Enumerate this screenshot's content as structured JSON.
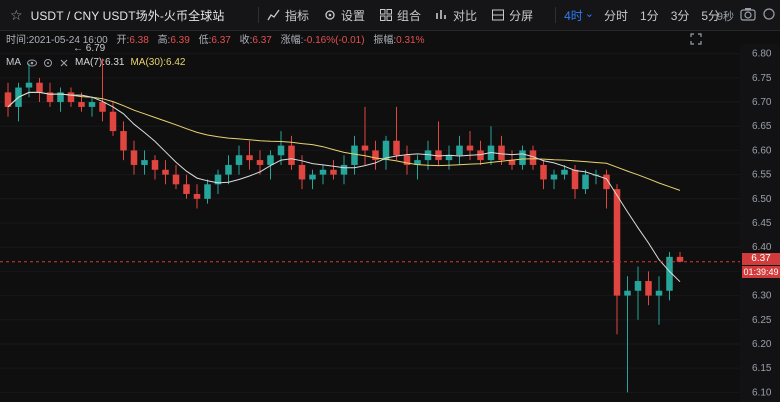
{
  "toolbar": {
    "symbol": "USDT / CNY  USDT场外-火币全球站",
    "tools": [
      {
        "label": "指标",
        "icon": "indicator-icon"
      },
      {
        "label": "设置",
        "icon": "gear-icon"
      },
      {
        "label": "组合",
        "icon": "grid-icon"
      },
      {
        "label": "对比",
        "icon": "compare-icon"
      },
      {
        "label": "分屏",
        "icon": "split-icon"
      }
    ],
    "periods": [
      "4时",
      "分时",
      "1分",
      "3分",
      "5分"
    ],
    "active_period": "4时",
    "countdown": "9秒"
  },
  "info": {
    "time_label": "时间:",
    "time_value": "2021-05-24 16:00",
    "open_label": "开:",
    "open_value": "6.38",
    "high_label": "高:",
    "high_value": "6.39",
    "low_label": "低:",
    "low_value": "6.37",
    "close_label": "收:",
    "close_value": "6.37",
    "change_label": "涨幅:",
    "change_value": "-0.16%(-0.01)",
    "amp_label": "振幅:",
    "amp_value": "0.31%"
  },
  "ma": {
    "name": "MA",
    "ma7_label": "MA(7):6.31",
    "ma30_label": "MA(30):6.42"
  },
  "peak_label": "6.79",
  "price_tag": "6.37",
  "time_tag": "01:39:49",
  "colors": {
    "up": "#26a69a",
    "down": "#e0463f",
    "ma7": "#dcdcdc",
    "ma30": "#e8d36f",
    "accent": "#2f7cf6"
  },
  "chart_data": {
    "type": "candlestick",
    "y_ticks": [
      "6.80",
      "6.75",
      "6.70",
      "6.65",
      "6.60",
      "6.55",
      "6.50",
      "6.45",
      "6.40",
      "6.35",
      "6.30",
      "6.25",
      "6.20",
      "6.15",
      "6.10"
    ],
    "ylim": [
      6.08,
      6.82
    ],
    "current_price": 6.37,
    "candles": [
      [
        6.72,
        6.74,
        6.67,
        6.69
      ],
      [
        6.69,
        6.74,
        6.66,
        6.73
      ],
      [
        6.73,
        6.78,
        6.71,
        6.74
      ],
      [
        6.74,
        6.75,
        6.7,
        6.72
      ],
      [
        6.72,
        6.74,
        6.69,
        6.7
      ],
      [
        6.7,
        6.73,
        6.68,
        6.72
      ],
      [
        6.72,
        6.73,
        6.69,
        6.7
      ],
      [
        6.7,
        6.72,
        6.68,
        6.69
      ],
      [
        6.69,
        6.71,
        6.67,
        6.7
      ],
      [
        6.7,
        6.79,
        6.66,
        6.68
      ],
      [
        6.68,
        6.7,
        6.63,
        6.64
      ],
      [
        6.64,
        6.66,
        6.58,
        6.6
      ],
      [
        6.6,
        6.62,
        6.55,
        6.57
      ],
      [
        6.57,
        6.6,
        6.55,
        6.58
      ],
      [
        6.58,
        6.59,
        6.54,
        6.56
      ],
      [
        6.56,
        6.58,
        6.53,
        6.55
      ],
      [
        6.55,
        6.57,
        6.52,
        6.53
      ],
      [
        6.53,
        6.55,
        6.5,
        6.51
      ],
      [
        6.51,
        6.53,
        6.48,
        6.5
      ],
      [
        6.5,
        6.54,
        6.49,
        6.53
      ],
      [
        6.53,
        6.56,
        6.51,
        6.55
      ],
      [
        6.55,
        6.59,
        6.53,
        6.57
      ],
      [
        6.57,
        6.61,
        6.55,
        6.59
      ],
      [
        6.59,
        6.62,
        6.56,
        6.58
      ],
      [
        6.58,
        6.6,
        6.55,
        6.57
      ],
      [
        6.57,
        6.6,
        6.54,
        6.59
      ],
      [
        6.59,
        6.64,
        6.57,
        6.61
      ],
      [
        6.61,
        6.63,
        6.56,
        6.57
      ],
      [
        6.57,
        6.59,
        6.52,
        6.54
      ],
      [
        6.54,
        6.56,
        6.52,
        6.55
      ],
      [
        6.55,
        6.57,
        6.53,
        6.56
      ],
      [
        6.56,
        6.58,
        6.54,
        6.55
      ],
      [
        6.55,
        6.59,
        6.53,
        6.57
      ],
      [
        6.57,
        6.63,
        6.55,
        6.61
      ],
      [
        6.61,
        6.69,
        6.57,
        6.6
      ],
      [
        6.6,
        6.62,
        6.56,
        6.58
      ],
      [
        6.58,
        6.63,
        6.56,
        6.62
      ],
      [
        6.62,
        6.69,
        6.58,
        6.59
      ],
      [
        6.59,
        6.61,
        6.55,
        6.57
      ],
      [
        6.57,
        6.59,
        6.54,
        6.58
      ],
      [
        6.58,
        6.62,
        6.56,
        6.6
      ],
      [
        6.6,
        6.66,
        6.57,
        6.58
      ],
      [
        6.58,
        6.61,
        6.56,
        6.59
      ],
      [
        6.59,
        6.63,
        6.57,
        6.61
      ],
      [
        6.61,
        6.64,
        6.58,
        6.6
      ],
      [
        6.6,
        6.62,
        6.57,
        6.58
      ],
      [
        6.58,
        6.65,
        6.57,
        6.61
      ],
      [
        6.61,
        6.63,
        6.57,
        6.58
      ],
      [
        6.58,
        6.6,
        6.56,
        6.57
      ],
      [
        6.57,
        6.61,
        6.56,
        6.6
      ],
      [
        6.6,
        6.61,
        6.56,
        6.57
      ],
      [
        6.57,
        6.58,
        6.52,
        6.54
      ],
      [
        6.54,
        6.56,
        6.52,
        6.55
      ],
      [
        6.55,
        6.57,
        6.54,
        6.56
      ],
      [
        6.56,
        6.57,
        6.5,
        6.52
      ],
      [
        6.52,
        6.56,
        6.51,
        6.55
      ],
      [
        6.55,
        6.56,
        6.53,
        6.55
      ],
      [
        6.55,
        6.56,
        6.48,
        6.52
      ],
      [
        6.52,
        6.53,
        6.22,
        6.3
      ],
      [
        6.3,
        6.34,
        6.1,
        6.31
      ],
      [
        6.31,
        6.36,
        6.25,
        6.33
      ],
      [
        6.33,
        6.35,
        6.28,
        6.3
      ],
      [
        6.3,
        6.34,
        6.24,
        6.31
      ],
      [
        6.31,
        6.39,
        6.29,
        6.38
      ],
      [
        6.38,
        6.39,
        6.37,
        6.37
      ]
    ]
  }
}
